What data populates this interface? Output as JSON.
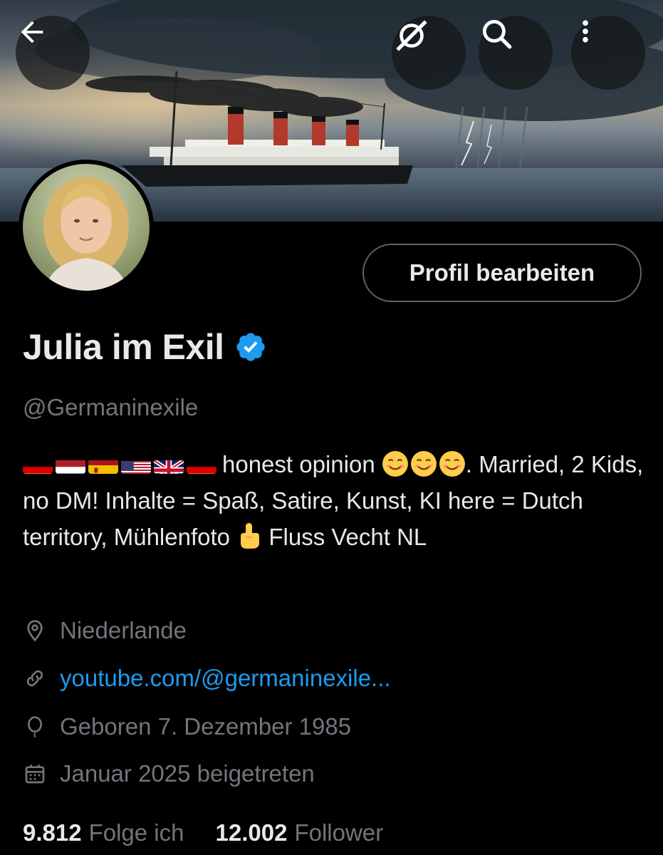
{
  "profile": {
    "display_name": "Julia im Exil",
    "handle": "@Germaninexile",
    "edit_button": "Profil bearbeiten",
    "bio": {
      "flags": [
        "de",
        "nl",
        "es",
        "us",
        "gb",
        "de"
      ],
      "segment1": "honest opinion",
      "emoji_count": 3,
      "segment2": ".  Married, 2 Kids, no DM! Inhalte = Spaß, Satire, Kunst, KI here = Dutch territory, Mühlenfoto",
      "pointer_emoji": "backhand-index-pointing-up",
      "segment3": "Fluss Vecht NL"
    },
    "location": "Niederlande",
    "website": "youtube.com/@germaninexile...",
    "birthday": "Geboren 7. Dezember 1985",
    "joined": "Januar 2025 beigetreten",
    "following_count": "9.812",
    "following_label": "Folge ich",
    "followers_count": "12.002",
    "followers_label": "Follower"
  },
  "header_buttons": {
    "back": "back-arrow-icon",
    "grok": "grok-icon",
    "search": "search-icon",
    "more": "more-vertical-icon"
  },
  "colors": {
    "background": "#000000",
    "text_primary": "#e7e9ea",
    "text_secondary": "#71767b",
    "link": "#1d9bf0",
    "verified": "#1d9bf0",
    "border": "#536471"
  }
}
